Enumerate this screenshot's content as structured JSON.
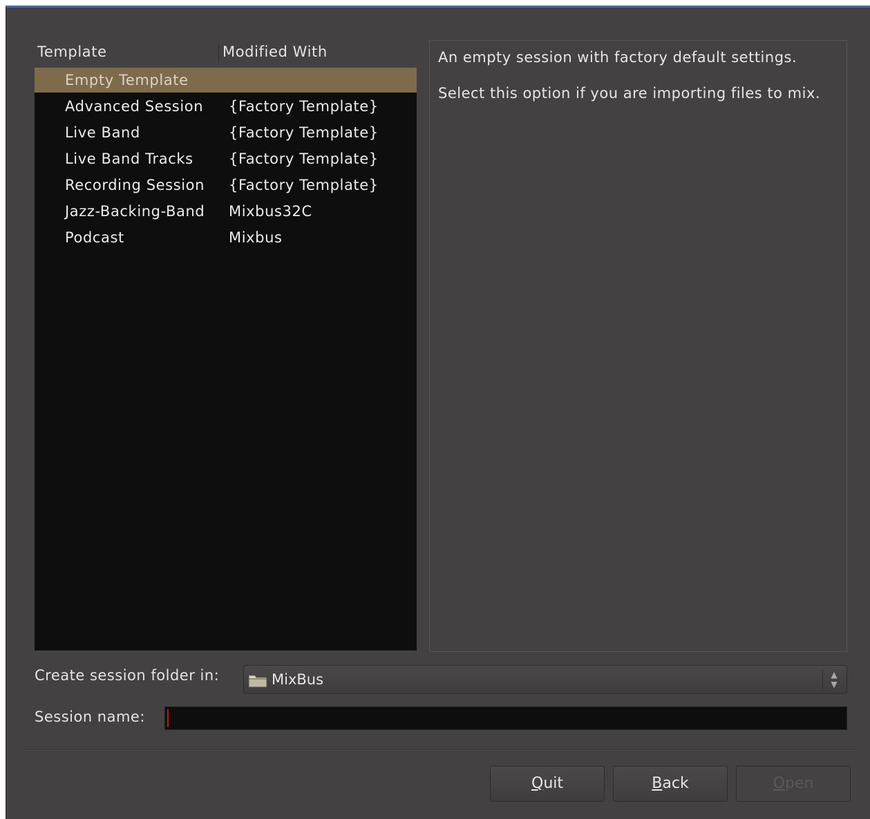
{
  "list": {
    "header_template": "Template",
    "header_modified": "Modified With",
    "rows": [
      {
        "name": "Empty Template",
        "modified": ""
      },
      {
        "name": "Advanced Session",
        "modified": "{Factory Template}"
      },
      {
        "name": "Live Band",
        "modified": "{Factory Template}"
      },
      {
        "name": "Live Band Tracks",
        "modified": "{Factory Template}"
      },
      {
        "name": "Recording Session",
        "modified": "{Factory Template}"
      },
      {
        "name": "Jazz-Backing-Band",
        "modified": "Mixbus32C"
      },
      {
        "name": "Podcast",
        "modified": "Mixbus"
      }
    ]
  },
  "description": {
    "line1": "An empty session with factory default settings.",
    "line2": "Select this option if you are importing files to mix."
  },
  "folder": {
    "label": "Create session folder in:",
    "value": "MixBus",
    "icon": "folder-icon"
  },
  "session": {
    "label": "Session name:",
    "value": ""
  },
  "buttons": {
    "quit_mnemonic": "Q",
    "quit_rest": "uit",
    "back_mnemonic": "B",
    "back_rest": "ack",
    "open_mnemonic": "O",
    "open_rest": "pen"
  },
  "colors": {
    "selected_row": "#7e6b4b",
    "list_bg": "#0e0e0e",
    "window_bg": "#434141"
  }
}
